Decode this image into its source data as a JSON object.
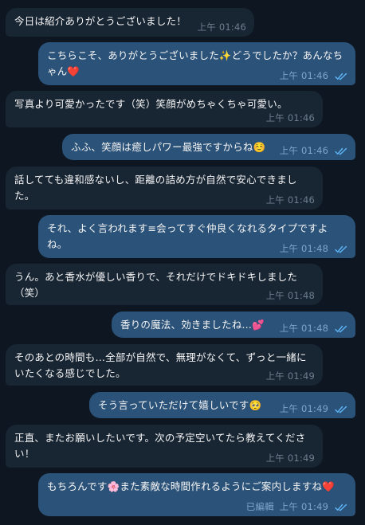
{
  "messages": [
    {
      "direction": "incoming",
      "text": "今日は紹介ありがとうございました！",
      "time": "上午 01:46"
    },
    {
      "direction": "outgoing",
      "text": "こちらこそ、ありがとうございました✨どうでしたか？あんなちゃん❤️",
      "time": "上午 01:46"
    },
    {
      "direction": "incoming",
      "text": "写真より可愛かったです（笑）笑顔がめちゃくちゃ可愛い。",
      "time": "上午 01:46"
    },
    {
      "direction": "outgoing",
      "text": "ふふ、笑顔は癒しパワー最強ですからね☺️",
      "time": "上午 01:46"
    },
    {
      "direction": "incoming",
      "text": "話してても違和感ないし、距離の詰め方が自然で安心できました。",
      "time": "上午 01:46"
    },
    {
      "direction": "outgoing",
      "text": "それ、よく言われます≡会ってすぐ仲良くなれるタイプですよね。",
      "time": "上午 01:48"
    },
    {
      "direction": "incoming",
      "text": "うん。あと香水が優しい香りで、それだけでドキドキしました（笑）",
      "time": "上午 01:48"
    },
    {
      "direction": "outgoing",
      "text": "香りの魔法、効きましたね…💕",
      "time": "上午 01:48"
    },
    {
      "direction": "incoming",
      "text": "そのあとの時間も…全部が自然で、無理がなくて、ずっと一緒にいたくなる感じでした。",
      "time": "上午 01:49"
    },
    {
      "direction": "outgoing",
      "text": "そう言っていただけて嬉しいです🥺",
      "time": "上午 01:49"
    },
    {
      "direction": "incoming",
      "text": "正直、またお願いしたいです。次の予定空いてたら教えてください！",
      "time": "上午 01:49"
    },
    {
      "direction": "outgoing",
      "text": "もちろんです🌸また素敵な時間作れるようにご案内しますね❤️",
      "time": "上午 01:49",
      "edited": "已編輯"
    }
  ],
  "colors": {
    "background": "#0e1621",
    "incoming_bubble": "#182533",
    "outgoing_bubble": "#2b5278",
    "text": "#f5f5f5",
    "incoming_time": "#6d7f8f",
    "outgoing_time": "#7ea6cc",
    "read_check": "#5eb5f7"
  },
  "icons": {
    "read_receipt": "double-check-icon"
  }
}
